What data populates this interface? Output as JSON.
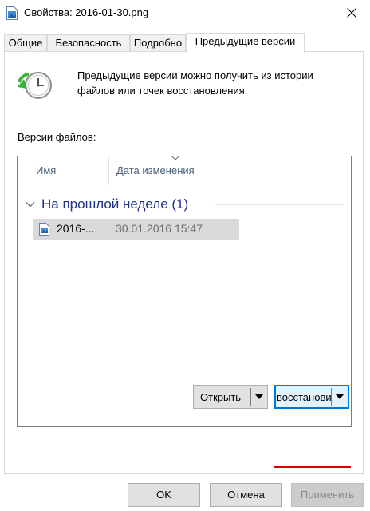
{
  "window": {
    "title": "Свойства: 2016-01-30.png",
    "title_icon": "image-file-icon",
    "close_icon": "close-icon"
  },
  "tabs": [
    {
      "label": "Общие"
    },
    {
      "label": "Безопасность"
    },
    {
      "label": "Подробно"
    },
    {
      "label": "Предыдущие версии",
      "active": true
    }
  ],
  "panel": {
    "intro_text": "Предыдущие версии можно получить из истории файлов или точек восстановления.",
    "versions_label": "Версии файлов:",
    "columns": {
      "name": "Имя",
      "date_modified": "Дата изменения"
    },
    "group": {
      "title": "На прошлой неделе (1)"
    },
    "files": [
      {
        "name": "2016-...",
        "date": "30.01.2016 15:47"
      }
    ],
    "open_button": "Открыть",
    "restore_button": "восстановит"
  },
  "buttons": {
    "ok": "OK",
    "cancel": "Отмена",
    "apply": "Применить"
  },
  "colors": {
    "focus_border": "#0078d7",
    "group_title": "#1e3287",
    "selection": "#d9d9d9",
    "annotation_underline": "#d40000"
  }
}
